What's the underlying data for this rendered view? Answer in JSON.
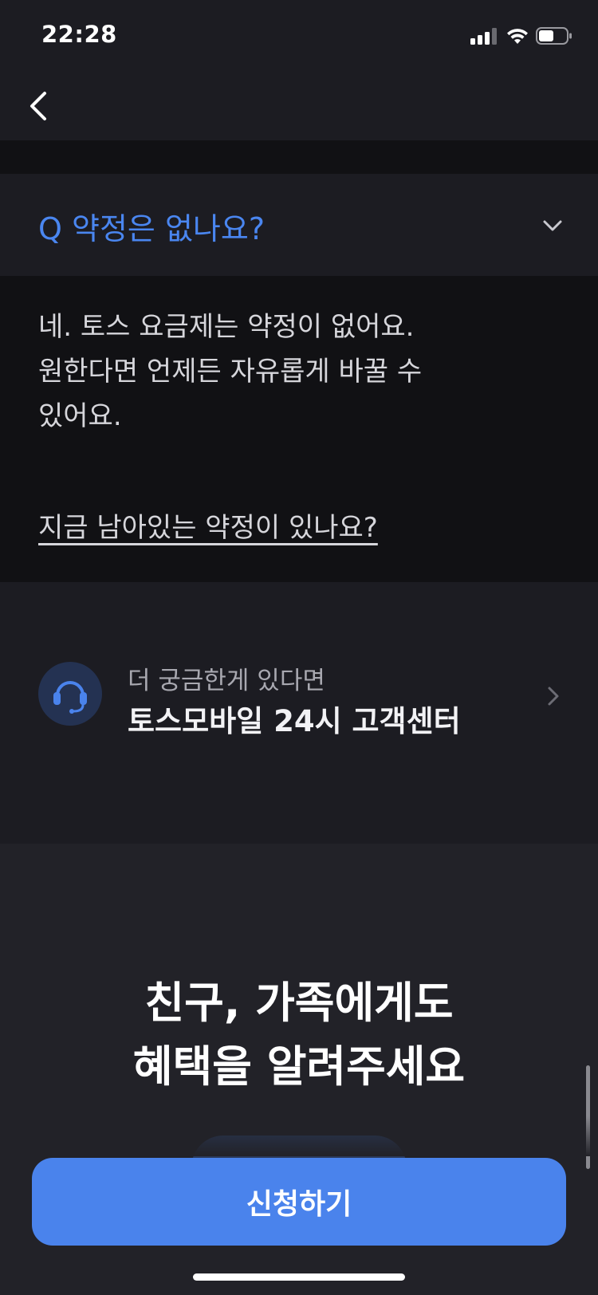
{
  "status_bar": {
    "time": "22:28"
  },
  "faq": {
    "question": "Q  약정은 없나요?",
    "answer_lines": [
      "네. 토스 요금제는 약정이 없어요.",
      "원한다면 언제든 자유롭게 바꿀 수",
      "있어요."
    ],
    "link": "지금 남아있는 약정이 있나요?"
  },
  "support": {
    "subtitle": "더 궁금한게 있다면",
    "title": "토스모바일 24시 고객센터"
  },
  "promo": {
    "title_lines": [
      "친구, 가족에게도",
      "혜택을 알려주세요"
    ]
  },
  "cta": {
    "label": "신청하기"
  },
  "colors": {
    "accent": "#4a83ec",
    "question_blue": "#4a86f0",
    "background": "#1c1c22",
    "answer_background": "#111114"
  },
  "icons": {
    "back": "chevron-left-icon",
    "expand": "chevron-down-icon",
    "support": "headset-icon",
    "forward": "chevron-right-icon"
  }
}
